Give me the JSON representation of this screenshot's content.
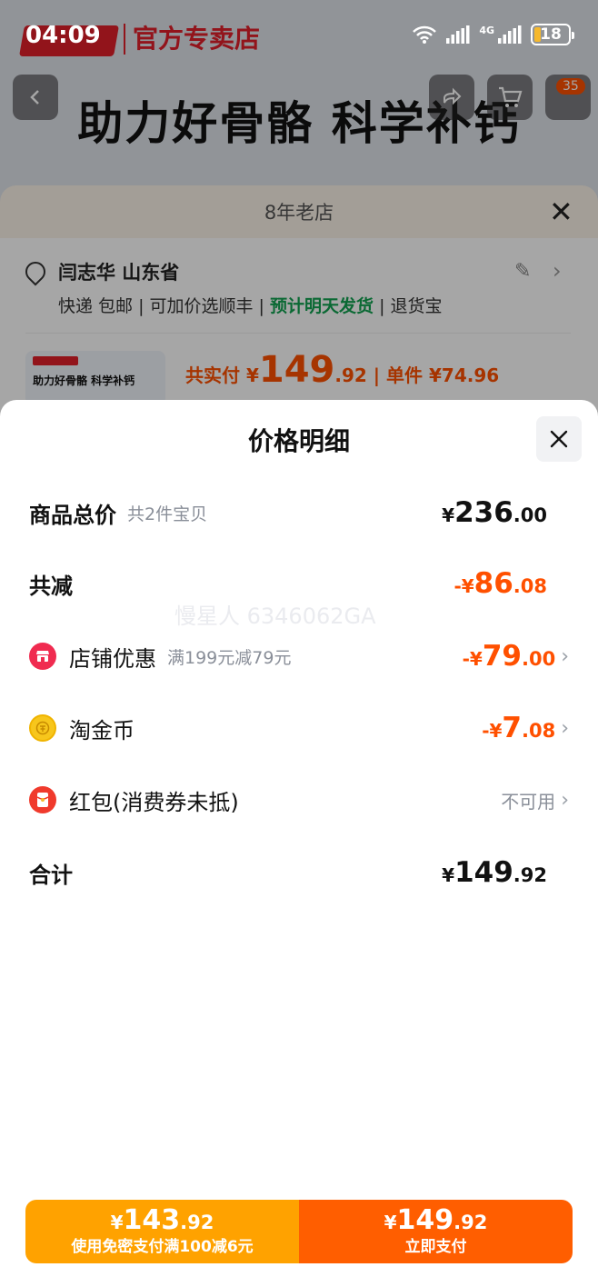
{
  "status_bar": {
    "time": "04:09",
    "network": "4G",
    "battery": "18"
  },
  "background": {
    "brand_name": "官方专卖店",
    "headline": "助力好骨骼 科学补钙",
    "cart_badge": "35",
    "sheet_title": "8年老店",
    "address_name": "闫志华 山东省",
    "shipping_prefix": "快递 包邮 | 可加价选顺丰 | ",
    "shipping_eta": "预计明天发货",
    "shipping_suffix": " | 退货宝",
    "thumb_text": "助力好骨骼 科学补钙",
    "pay_label": "共实付 ¥",
    "pay_int": "149",
    "pay_dec": ".92",
    "unit_price": " | 单件 ¥74.96"
  },
  "sheet": {
    "title": "价格明细",
    "watermark": "慢星人 6346062GA",
    "rows": {
      "total": {
        "label": "商品总价",
        "sub": "共2件宝贝",
        "sym": "¥",
        "int": "236",
        "dec": ".00"
      },
      "reduction": {
        "label": "共减",
        "sym": "-¥",
        "int": "86",
        "dec": ".08"
      },
      "shop_discount": {
        "label": "店铺优惠",
        "sub": "满199元减79元",
        "sym": "-¥",
        "int": "79",
        "dec": ".00"
      },
      "gold_coin": {
        "label": "淘金币",
        "sym": "-¥",
        "int": "7",
        "dec": ".08"
      },
      "red_packet": {
        "label": "红包(消费券未抵)",
        "value": "不可用"
      },
      "sum": {
        "label": "合计",
        "sym": "¥",
        "int": "149",
        "dec": ".92"
      }
    }
  },
  "pay_bar": {
    "quick": {
      "sym": "¥",
      "int": "143",
      "dec": ".92",
      "caption": "使用免密支付满100减6元"
    },
    "now": {
      "sym": "¥",
      "int": "149",
      "dec": ".92",
      "caption": "立即支付"
    }
  },
  "colors": {
    "accent_orange": "#ff5000",
    "quick_pay": "#ffa200",
    "pay_now": "#ff5e00",
    "eta_green": "#12a150"
  }
}
